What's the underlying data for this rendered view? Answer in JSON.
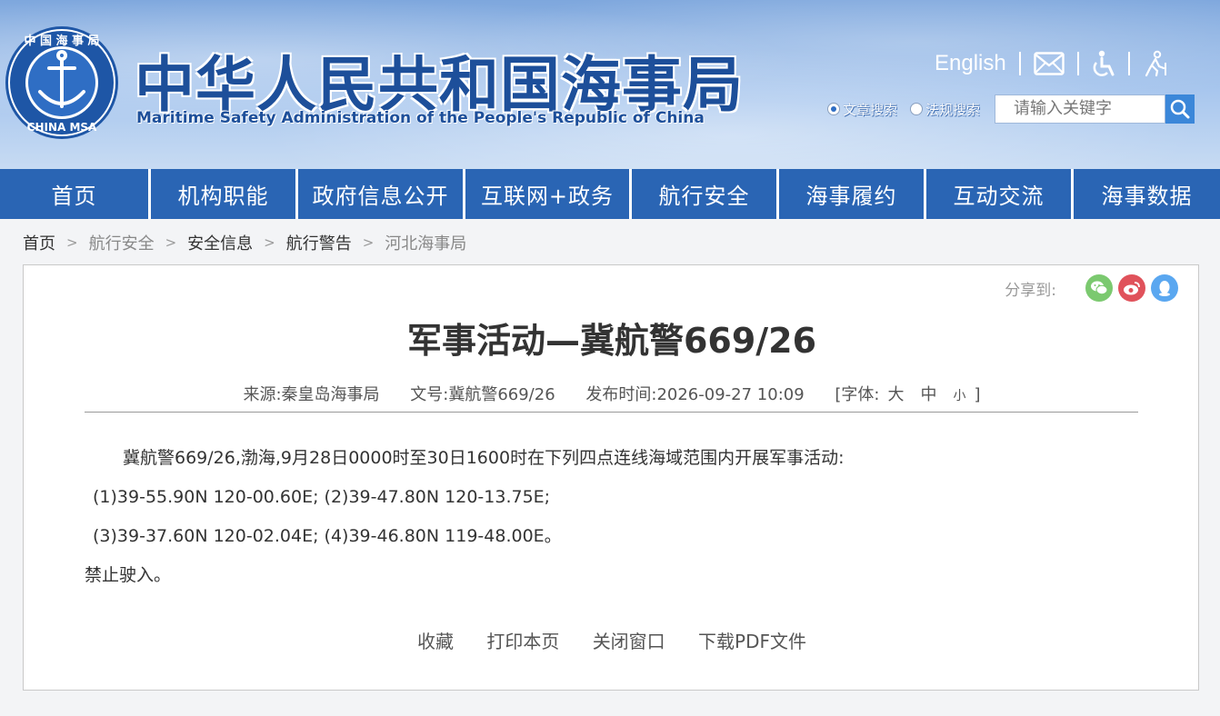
{
  "header": {
    "title_cn": "中华人民共和国海事局",
    "title_en": "Maritime Safety Administration of the People's Republic of China",
    "logo_text": {
      "top": "中国海事局",
      "bottom": "CHINA MSA"
    },
    "english_link": "English",
    "icons": [
      "mail-icon",
      "accessibility-icon",
      "elder-mode-icon",
      "search-icon"
    ],
    "search": {
      "option_article": "文章搜索",
      "option_law": "法规搜索",
      "selected": "文章搜索",
      "placeholder": "请输入关键字"
    }
  },
  "nav": {
    "items": [
      {
        "label": "首页"
      },
      {
        "label": "机构职能"
      },
      {
        "label": "政府信息公开"
      },
      {
        "label": "互联网+政务"
      },
      {
        "label": "航行安全"
      },
      {
        "label": "海事履约"
      },
      {
        "label": "互动交流"
      },
      {
        "label": "海事数据"
      }
    ]
  },
  "breadcrumb": {
    "items": [
      {
        "label": "首页"
      },
      {
        "label": "航行安全"
      },
      {
        "label": "安全信息"
      },
      {
        "label": "航行警告"
      },
      {
        "label": "河北海事局"
      }
    ],
    "separator": ">"
  },
  "article": {
    "share_label": "分享到:",
    "title": "军事活动—冀航警669/26",
    "meta": {
      "source": "来源:秦皇岛海事局",
      "doc_no": "文号:冀航警669/26",
      "published": "发布时间:2026-09-27 10:09",
      "font_label": "[字体:",
      "font_large": "大",
      "font_medium": "中",
      "font_small": "小",
      "font_close": "]"
    },
    "body": [
      "冀航警669/26,渤海,9月28日0000时至30日1600时在下列四点连线海域范围内开展军事活动:",
      "(1)39-55.90N 120-00.60E; (2)39-47.80N 120-13.75E;",
      "(3)39-37.60N 120-02.04E; (4)39-46.80N 119-48.00E。",
      "禁止驶入。"
    ],
    "actions": {
      "favorite": "收藏",
      "print": "打印本页",
      "close": "关闭窗口",
      "download": "下载PDF文件"
    }
  },
  "colors": {
    "nav_bg": "#2a65b4",
    "title_blue": "#1d4f9a",
    "wechat": "#7bc96f",
    "weibo": "#e0525b",
    "qq": "#5aa7f0"
  }
}
